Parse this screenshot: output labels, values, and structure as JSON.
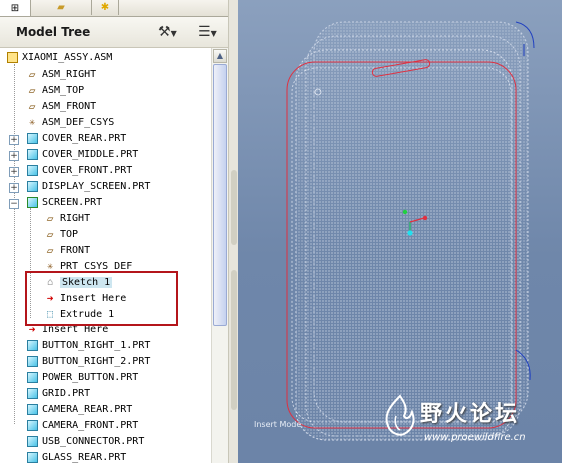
{
  "panel": {
    "tabs": [
      {
        "name": "model-tree-tab"
      },
      {
        "name": "folder-browser-tab"
      },
      {
        "name": "favorites-tab"
      }
    ],
    "header": {
      "title": "Model Tree",
      "tools_icon": "hammer-icon",
      "settings_icon": "tree-settings-icon"
    }
  },
  "tree": {
    "root": "XIAOMI_ASSY.ASM",
    "asm_items": [
      "ASM_RIGHT",
      "ASM_TOP",
      "ASM_FRONT",
      "ASM_DEF_CSYS"
    ],
    "parts_top": [
      "COVER_REAR.PRT",
      "COVER_MIDDLE.PRT",
      "COVER_FRONT.PRT",
      "DISPLAY_SCREEN.PRT"
    ],
    "screen": {
      "label": "SCREEN.PRT",
      "children": [
        "RIGHT",
        "TOP",
        "FRONT",
        "PRT_CSYS_DEF"
      ],
      "sketch": "Sketch 1",
      "insert_here": "Insert Here",
      "extrude": "Extrude 1"
    },
    "asm_insert_here": "Insert Here",
    "parts_bottom": [
      "BUTTON_RIGHT_1.PRT",
      "BUTTON_RIGHT_2.PRT",
      "POWER_BUTTON.PRT",
      "GRID.PRT",
      "CAMERA_REAR.PRT",
      "CAMERA_FRONT.PRT",
      "USB_CONNECTOR.PRT",
      "GLASS_REAR.PRT"
    ]
  },
  "viewport": {
    "mode_text": "Insert Mode",
    "watermark_title": "野火论坛",
    "watermark_url": "www.proewildfire.cn",
    "colors": {
      "background": "#7a90b2",
      "sketch_red": "#e03040",
      "edge_blue": "#2040c0"
    }
  }
}
